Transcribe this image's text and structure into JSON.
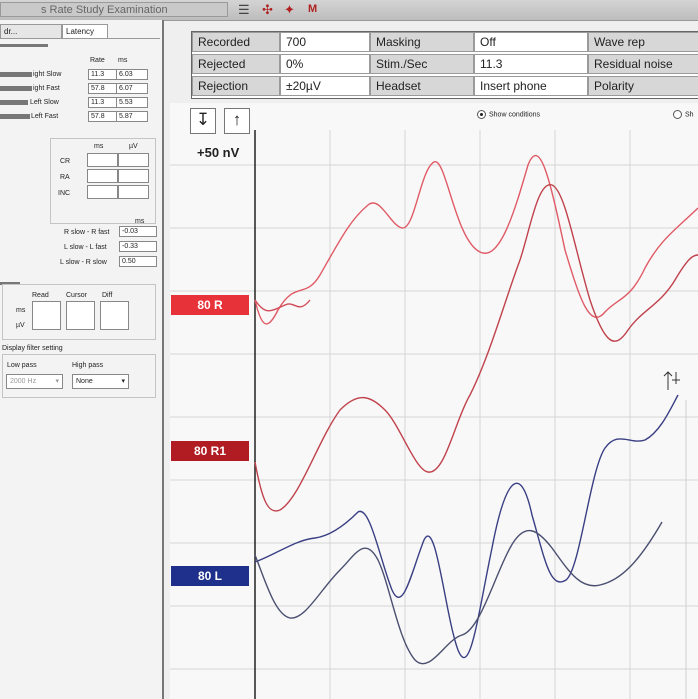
{
  "titlebar": {
    "title": "s Rate Study Examination"
  },
  "tabs": [
    "dr...",
    "Latency"
  ],
  "rate_table": {
    "headers": [
      "Rate",
      "ms"
    ],
    "rows": [
      {
        "label": "ight Slow",
        "rate": "11.3",
        "ms": "6.03"
      },
      {
        "label": "ight Fast",
        "rate": "57.8",
        "ms": "6.07"
      },
      {
        "label": "Left Slow",
        "rate": "11.3",
        "ms": "5.53"
      },
      {
        "label": "Left Fast",
        "rate": "57.8",
        "ms": "5.87"
      }
    ]
  },
  "measure_table": {
    "headers": [
      "ms",
      "µV"
    ],
    "rows": [
      "CR",
      "RA",
      "INC"
    ]
  },
  "diff_table": {
    "header": "ms",
    "rows": [
      {
        "label": "R slow - R fast",
        "value": "-0.03"
      },
      {
        "label": "L slow - L fast",
        "value": "-0.33"
      },
      {
        "label": "L slow - R slow",
        "value": "0.50"
      }
    ]
  },
  "cursor_panel": {
    "headers": [
      "Read",
      "Cursor",
      "Diff"
    ],
    "row_labels": [
      "ms",
      "µV"
    ]
  },
  "display_filter": {
    "title": "Display filter setting",
    "low_pass_label": "Low pass",
    "low_pass_value": "2000 Hz",
    "high_pass_label": "High pass",
    "high_pass_value": "None"
  },
  "info": {
    "rows": [
      [
        "Recorded",
        "700",
        "Masking",
        "Off",
        "Wave rep"
      ],
      [
        "Rejected",
        "0%",
        "Stim./Sec",
        "11.3",
        "Residual noise"
      ],
      [
        "Rejection",
        "±20µV",
        "Headset",
        "Insert phone",
        "Polarity"
      ]
    ]
  },
  "graph": {
    "scale_label": "+50 nV",
    "show_conditions": "Show conditions",
    "other_option": "Sh",
    "channels": [
      {
        "label": "80 R",
        "color": "#e8323a"
      },
      {
        "label": "80 R1",
        "color": "#b01c22"
      },
      {
        "label": "80 L",
        "color": "#1e2f8c"
      }
    ],
    "trace_colors": {
      "red": "#e05a66",
      "darkred": "#c0424c",
      "blue": "#3a3f84",
      "blue2": "#4a4f70"
    }
  }
}
